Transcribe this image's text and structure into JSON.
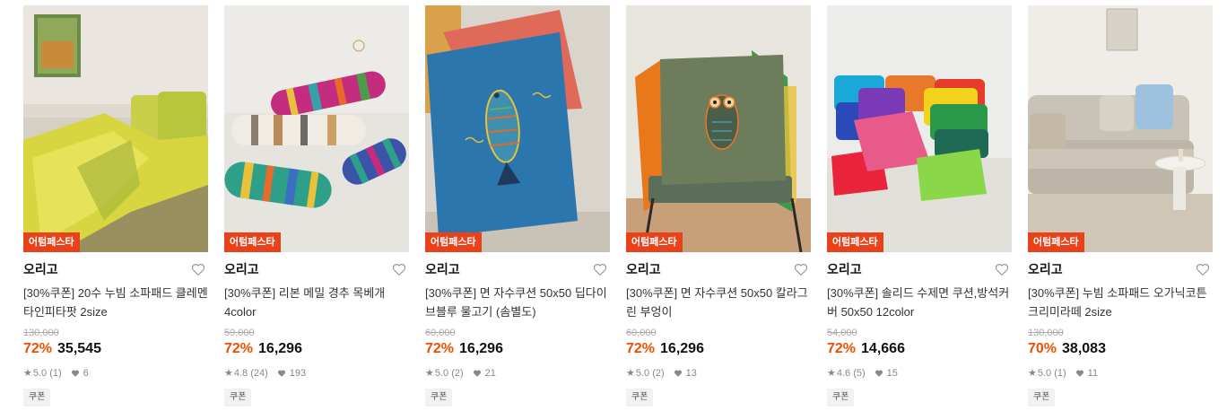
{
  "products": [
    {
      "badge": "어텀페스타",
      "brand": "오리고",
      "title": "[30%쿠폰] 20수 누빔 소파패드 클레멘타인피타팟 2size",
      "original_price": "130,000",
      "discount": "72%",
      "price": "35,545",
      "rating": "5.0 (1)",
      "likes": "6",
      "tag": "쿠폰"
    },
    {
      "badge": "어텀페스타",
      "brand": "오리고",
      "title": "[30%쿠폰] 리본 메밀 경추 목베개 4color",
      "original_price": "59,000",
      "discount": "72%",
      "price": "16,296",
      "rating": "4.8 (24)",
      "likes": "193",
      "tag": "쿠폰"
    },
    {
      "badge": "어텀페스타",
      "brand": "오리고",
      "title": "[30%쿠폰] 면 자수쿠션 50x50 딥다이브블루 물고기 (솜별도)",
      "original_price": "60,000",
      "discount": "72%",
      "price": "16,296",
      "rating": "5.0 (2)",
      "likes": "21",
      "tag": "쿠폰"
    },
    {
      "badge": "어텀페스타",
      "brand": "오리고",
      "title": "[30%쿠폰] 면 자수쿠션 50x50 칼라그린 부엉이",
      "original_price": "60,000",
      "discount": "72%",
      "price": "16,296",
      "rating": "5.0 (2)",
      "likes": "13",
      "tag": "쿠폰"
    },
    {
      "badge": "어텀페스타",
      "brand": "오리고",
      "title": "[30%쿠폰] 솔리드 수제면 쿠션,방석커버 50x50 12color",
      "original_price": "54,000",
      "discount": "72%",
      "price": "14,666",
      "rating": "4.6 (5)",
      "likes": "15",
      "tag": "쿠폰"
    },
    {
      "badge": "어텀페스타",
      "brand": "오리고",
      "title": "[30%쿠폰] 누빔 소파패드 오가닉코튼 크리미라떼 2size",
      "original_price": "130,000",
      "discount": "70%",
      "price": "38,083",
      "rating": "5.0 (1)",
      "likes": "11",
      "tag": "쿠폰"
    }
  ],
  "colors": {
    "badge_bg": "#e8421a",
    "discount": "#f04e00"
  },
  "icons": {
    "wishlist": "heart-outline-icon",
    "rating": "star-icon",
    "likes": "heart-filled-icon"
  }
}
